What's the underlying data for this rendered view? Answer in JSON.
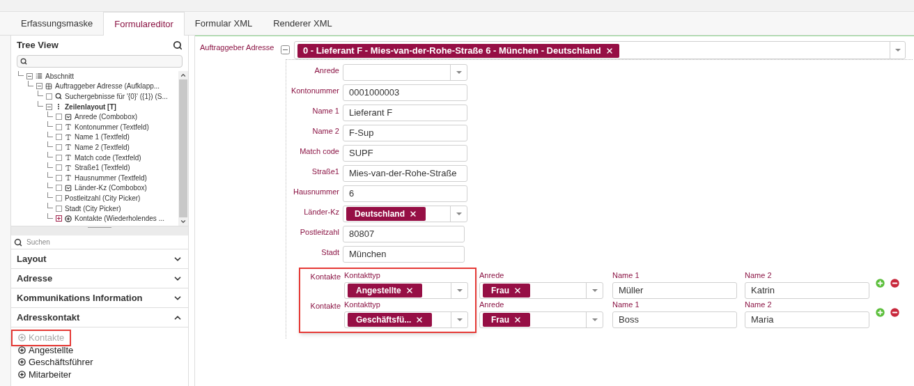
{
  "tabs": [
    {
      "label": "Erfassungsmaske",
      "selected": false
    },
    {
      "label": "Formulareditor",
      "selected": true
    },
    {
      "label": "Formular XML",
      "selected": false
    },
    {
      "label": "Renderer XML",
      "selected": false
    }
  ],
  "tree_view": {
    "title": "Tree View",
    "nodes": [
      {
        "label": "Abschnitt",
        "kind": "section",
        "expanded": true,
        "children": [
          {
            "label": "Auftraggeber Adresse (Aufklapp...",
            "kind": "panel",
            "expanded": true,
            "children": [
              {
                "label": "Suchergebnisse für '{0}' ({1}) (S...",
                "kind": "search"
              },
              {
                "label": "Zeilenlayout [T]",
                "kind": "rows",
                "emphasized": true,
                "expanded": true,
                "children": [
                  {
                    "label": "Anrede (Combobox)",
                    "kind": "combobox"
                  },
                  {
                    "label": "Kontonummer (Textfeld)",
                    "kind": "textfield"
                  },
                  {
                    "label": "Name 1 (Textfeld)",
                    "kind": "textfield"
                  },
                  {
                    "label": "Name 2 (Textfeld)",
                    "kind": "textfield"
                  },
                  {
                    "label": "Match code (Textfeld)",
                    "kind": "textfield"
                  },
                  {
                    "label": "Straße1 (Textfeld)",
                    "kind": "textfield"
                  },
                  {
                    "label": "Hausnummer (Textfeld)",
                    "kind": "textfield"
                  },
                  {
                    "label": "Länder-Kz (Combobox)",
                    "kind": "combobox"
                  },
                  {
                    "label": "Postleitzahl (City Picker)",
                    "kind": "picker"
                  },
                  {
                    "label": "Stadt (City Picker)",
                    "kind": "picker"
                  },
                  {
                    "label": "Kontakte (Wiederholendes ...",
                    "kind": "repeat",
                    "expanded": false
                  }
                ]
              }
            ]
          }
        ]
      }
    ]
  },
  "palette": {
    "search_placeholder": "Suchen",
    "sections": [
      {
        "title": "Layout",
        "expanded": false
      },
      {
        "title": "Adresse",
        "expanded": false
      },
      {
        "title": "Kommunikations Information",
        "expanded": false
      },
      {
        "title": "Adresskontakt",
        "expanded": true,
        "items": [
          {
            "label": "Kontakte",
            "disabled": true,
            "highlighted": true
          },
          {
            "label": "Angestellte",
            "disabled": false,
            "highlighted": false
          },
          {
            "label": "Geschäftsführer",
            "disabled": false,
            "highlighted": false
          },
          {
            "label": "Mitarbeiter",
            "disabled": false,
            "highlighted": false
          }
        ]
      }
    ]
  },
  "form": {
    "label": "Auftraggeber Adresse",
    "expanded": true,
    "tag": "0 - Lieferant F - Mies-van-der-Rohe-Straße 6 - München - Deutschland",
    "fields": [
      {
        "label": "Anrede",
        "kind": "combobox"
      },
      {
        "label": "Kontonummer",
        "kind": "text",
        "value": "0001000003"
      },
      {
        "label": "Name 1",
        "kind": "text",
        "value": "Lieferant F"
      },
      {
        "label": "Name 2",
        "kind": "text",
        "value": "F-Sup"
      },
      {
        "label": "Match code",
        "kind": "text",
        "value": "SUPF"
      },
      {
        "label": "Straße1",
        "kind": "text",
        "value": "Mies-van-der-Rohe-Straße"
      },
      {
        "label": "Hausnummer",
        "kind": "text",
        "value": "6"
      },
      {
        "label": "Länder-Kz",
        "kind": "combobox",
        "tag": "Deutschland"
      },
      {
        "label": "Postleitzahl",
        "kind": "city",
        "value": "80807"
      },
      {
        "label": "Stadt",
        "kind": "city",
        "value": "München"
      }
    ],
    "contacts": {
      "highlighted": true,
      "rows": [
        {
          "label": "Kontakte",
          "type_label": "Kontakttyp",
          "type_tag": "Angestellte",
          "salutation_label": "Anrede",
          "salutation_tag": "Frau",
          "name1_label": "Name 1",
          "name1": "Müller",
          "name2_label": "Name 2",
          "name2": "Katrin"
        },
        {
          "label": "Kontakte",
          "type_label": "Kontakttyp",
          "type_tag": "Geschäftsfü...",
          "salutation_label": "Anrede",
          "salutation_tag": "Frau",
          "name1_label": "Name 1",
          "name1": "Boss",
          "name2_label": "Name 2",
          "name2": "Maria"
        }
      ]
    }
  }
}
